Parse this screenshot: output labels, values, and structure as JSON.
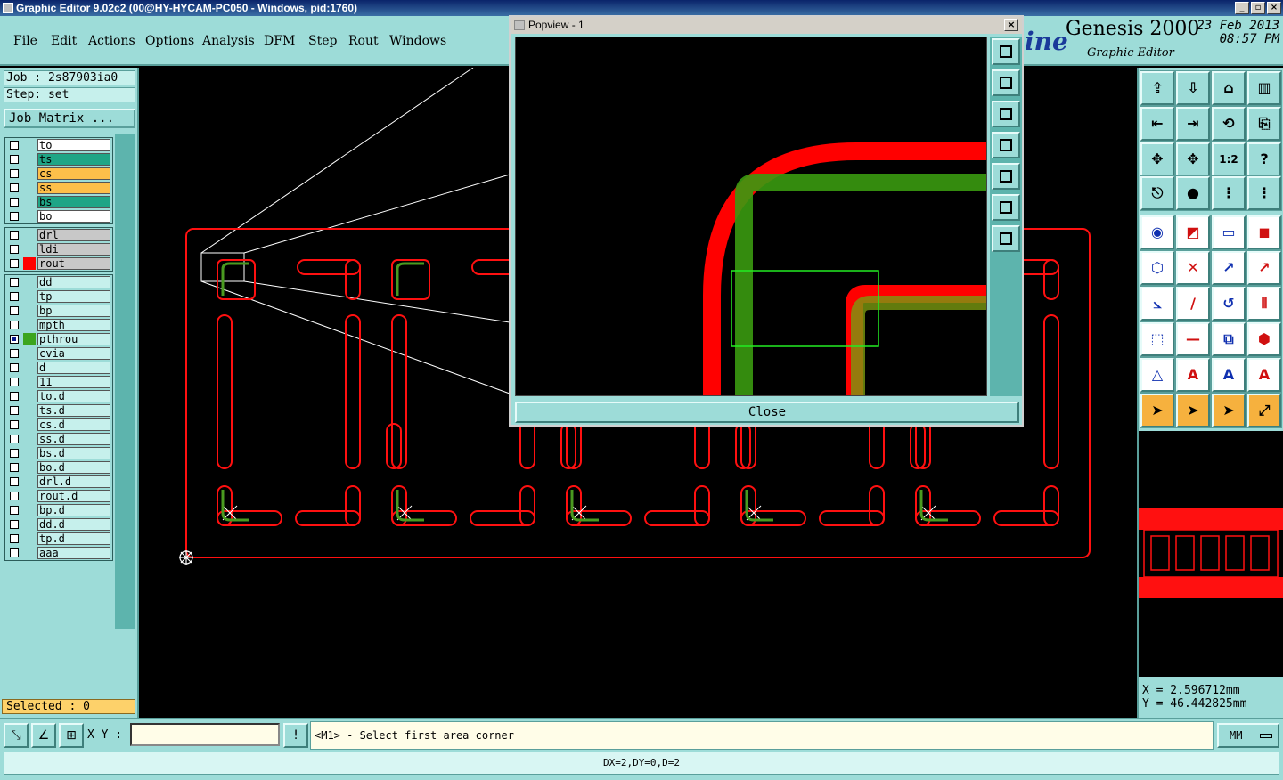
{
  "window": {
    "title": "Graphic Editor 9.02c2 (00@HY-HYCAM-PC050 - Windows, pid:1760)"
  },
  "menu": [
    "File",
    "Edit",
    "Actions",
    "Options",
    "Analysis",
    "DFM",
    "Step",
    "Rout",
    "Windows"
  ],
  "brand": {
    "logo_fragment": "ine",
    "title": "Genesis 2000",
    "subtitle": "Graphic Editor",
    "date": "23 Feb 2013",
    "time": "08:57 PM"
  },
  "job": {
    "job_label": "Job : 2s87903ia0",
    "step_label": "Step: set",
    "matrix_button": "Job Matrix ..."
  },
  "layers": {
    "board": [
      {
        "name": "to",
        "color": "#ffffff"
      },
      {
        "name": "ts",
        "color": "#1fa586"
      },
      {
        "name": "cs",
        "color": "#fdbf4a"
      },
      {
        "name": "ss",
        "color": "#fdbf4a"
      },
      {
        "name": "bs",
        "color": "#1fa586"
      },
      {
        "name": "bo",
        "color": "#ffffff"
      }
    ],
    "drill": [
      {
        "name": "drl",
        "color": "#c8c8c8",
        "swatch": ""
      },
      {
        "name": "ldi",
        "color": "#c8c8c8",
        "swatch": ""
      },
      {
        "name": "rout",
        "color": "#c8c8c8",
        "swatch": "#ff0000"
      }
    ],
    "misc": [
      {
        "name": "dd"
      },
      {
        "name": "tp"
      },
      {
        "name": "bp"
      },
      {
        "name": "mpth"
      },
      {
        "name": "pthrou",
        "swatch": "#3ca51e",
        "checked": true
      },
      {
        "name": "cvia"
      },
      {
        "name": "d"
      },
      {
        "name": "11"
      },
      {
        "name": "to.d"
      },
      {
        "name": "ts.d"
      },
      {
        "name": "cs.d"
      },
      {
        "name": "ss.d"
      },
      {
        "name": "bs.d"
      },
      {
        "name": "bo.d"
      },
      {
        "name": "drl.d"
      },
      {
        "name": "rout.d"
      },
      {
        "name": "bp.d"
      },
      {
        "name": "dd.d"
      },
      {
        "name": "tp.d"
      },
      {
        "name": "aaa"
      }
    ]
  },
  "selected_label": "Selected : 0",
  "popview": {
    "title": "Popview - 1",
    "close_label": "Close"
  },
  "coords": {
    "x": "X = 2.596712mm",
    "y": "Y = 46.442825mm"
  },
  "prompt": {
    "xy_label": "X Y :",
    "xy_value": "",
    "message": "<M1> - Select first area corner",
    "units": "MM"
  },
  "status": "DX=2,DY=0,D=2",
  "colors": {
    "panel": "#9ddcd8",
    "rout": "#ff0000",
    "pthrou": "#3ca51e",
    "selected": "#fdd16a"
  }
}
